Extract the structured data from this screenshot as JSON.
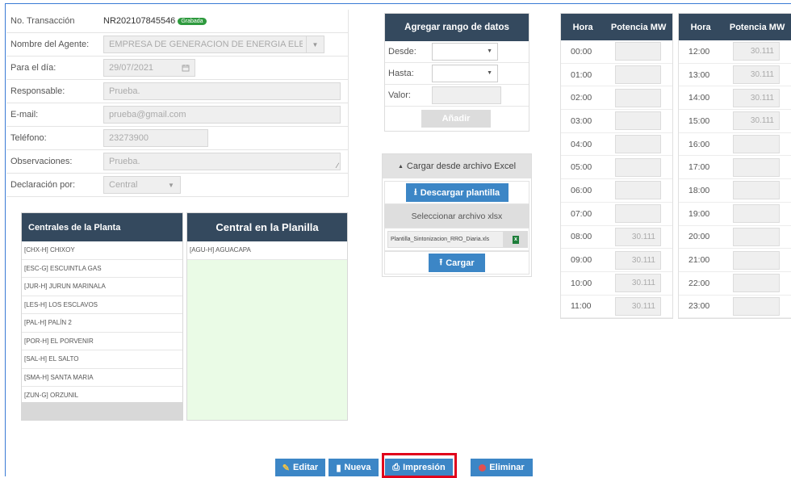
{
  "form": {
    "transaccion_label": "No. Transacción",
    "transaccion_value": "NR202107845546",
    "status_badge": "Grabada",
    "agente_label": "Nombre del Agente:",
    "agente_value": "EMPRESA DE GENERACION DE ENERGIA ELECTF",
    "dia_label": "Para el día:",
    "dia_value": "29/07/2021",
    "responsable_label": "Responsable:",
    "responsable_value": "Prueba.",
    "email_label": "E-mail:",
    "email_value": "prueba@gmail.com",
    "telefono_label": "Teléfono:",
    "telefono_value": "23273900",
    "observaciones_label": "Observaciones:",
    "observaciones_value": "Prueba.",
    "declaracion_label": "Declaración por:",
    "declaracion_value": "Central"
  },
  "centrales": {
    "header": "Centrales de la Planta",
    "items": [
      "[CHX-H] CHIXOY",
      "[ESC-G] ESCUINTLA GAS",
      "[JUR-H] JURUN MARINALA",
      "[LES-H] LOS ESCLAVOS",
      "[PAL-H] PALÍN 2",
      "[POR-H] EL PORVENIR",
      "[SAL-H] EL SALTO",
      "[SMA-H] SANTA MARIA",
      "[ZUN-G] ORZUNIL"
    ]
  },
  "planilla": {
    "header": "Central en la Planilla",
    "items": [
      "[AGU-H] AGUACAPA"
    ]
  },
  "rango": {
    "header": "Agregar rango de datos",
    "desde_label": "Desde:",
    "hasta_label": "Hasta:",
    "valor_label": "Valor:",
    "add_button": "Añadir"
  },
  "excel": {
    "header": "Cargar desde archivo Excel",
    "download_button": "Descargar plantilla",
    "select_label": "Seleccionar archivo xlsx",
    "file_name": "Plantilla_Sintonizacion_RRO_Diaria.xls",
    "upload_button": "Cargar"
  },
  "hours": {
    "hora_header": "Hora",
    "potencia_header": "Potencia MW",
    "left": [
      {
        "hora": "00:00",
        "valor": ""
      },
      {
        "hora": "01:00",
        "valor": ""
      },
      {
        "hora": "02:00",
        "valor": ""
      },
      {
        "hora": "03:00",
        "valor": ""
      },
      {
        "hora": "04:00",
        "valor": ""
      },
      {
        "hora": "05:00",
        "valor": ""
      },
      {
        "hora": "06:00",
        "valor": ""
      },
      {
        "hora": "07:00",
        "valor": ""
      },
      {
        "hora": "08:00",
        "valor": "30.111"
      },
      {
        "hora": "09:00",
        "valor": "30.111"
      },
      {
        "hora": "10:00",
        "valor": "30.111"
      },
      {
        "hora": "11:00",
        "valor": "30.111"
      }
    ],
    "right": [
      {
        "hora": "12:00",
        "valor": "30.111"
      },
      {
        "hora": "13:00",
        "valor": "30.111"
      },
      {
        "hora": "14:00",
        "valor": "30.111"
      },
      {
        "hora": "15:00",
        "valor": "30.111"
      },
      {
        "hora": "16:00",
        "valor": ""
      },
      {
        "hora": "17:00",
        "valor": ""
      },
      {
        "hora": "18:00",
        "valor": ""
      },
      {
        "hora": "19:00",
        "valor": ""
      },
      {
        "hora": "20:00",
        "valor": ""
      },
      {
        "hora": "21:00",
        "valor": ""
      },
      {
        "hora": "22:00",
        "valor": ""
      },
      {
        "hora": "23:00",
        "valor": ""
      }
    ]
  },
  "actions": {
    "edit": "Editar",
    "new": "Nueva",
    "print": "Impresión",
    "delete": "Eliminar"
  },
  "colors": {
    "header_dark": "#34495e",
    "button_blue": "#3c86c6",
    "highlight_red": "#e0001b",
    "badge_green": "#2e9a3e",
    "planilla_bg": "#eafbe6"
  }
}
